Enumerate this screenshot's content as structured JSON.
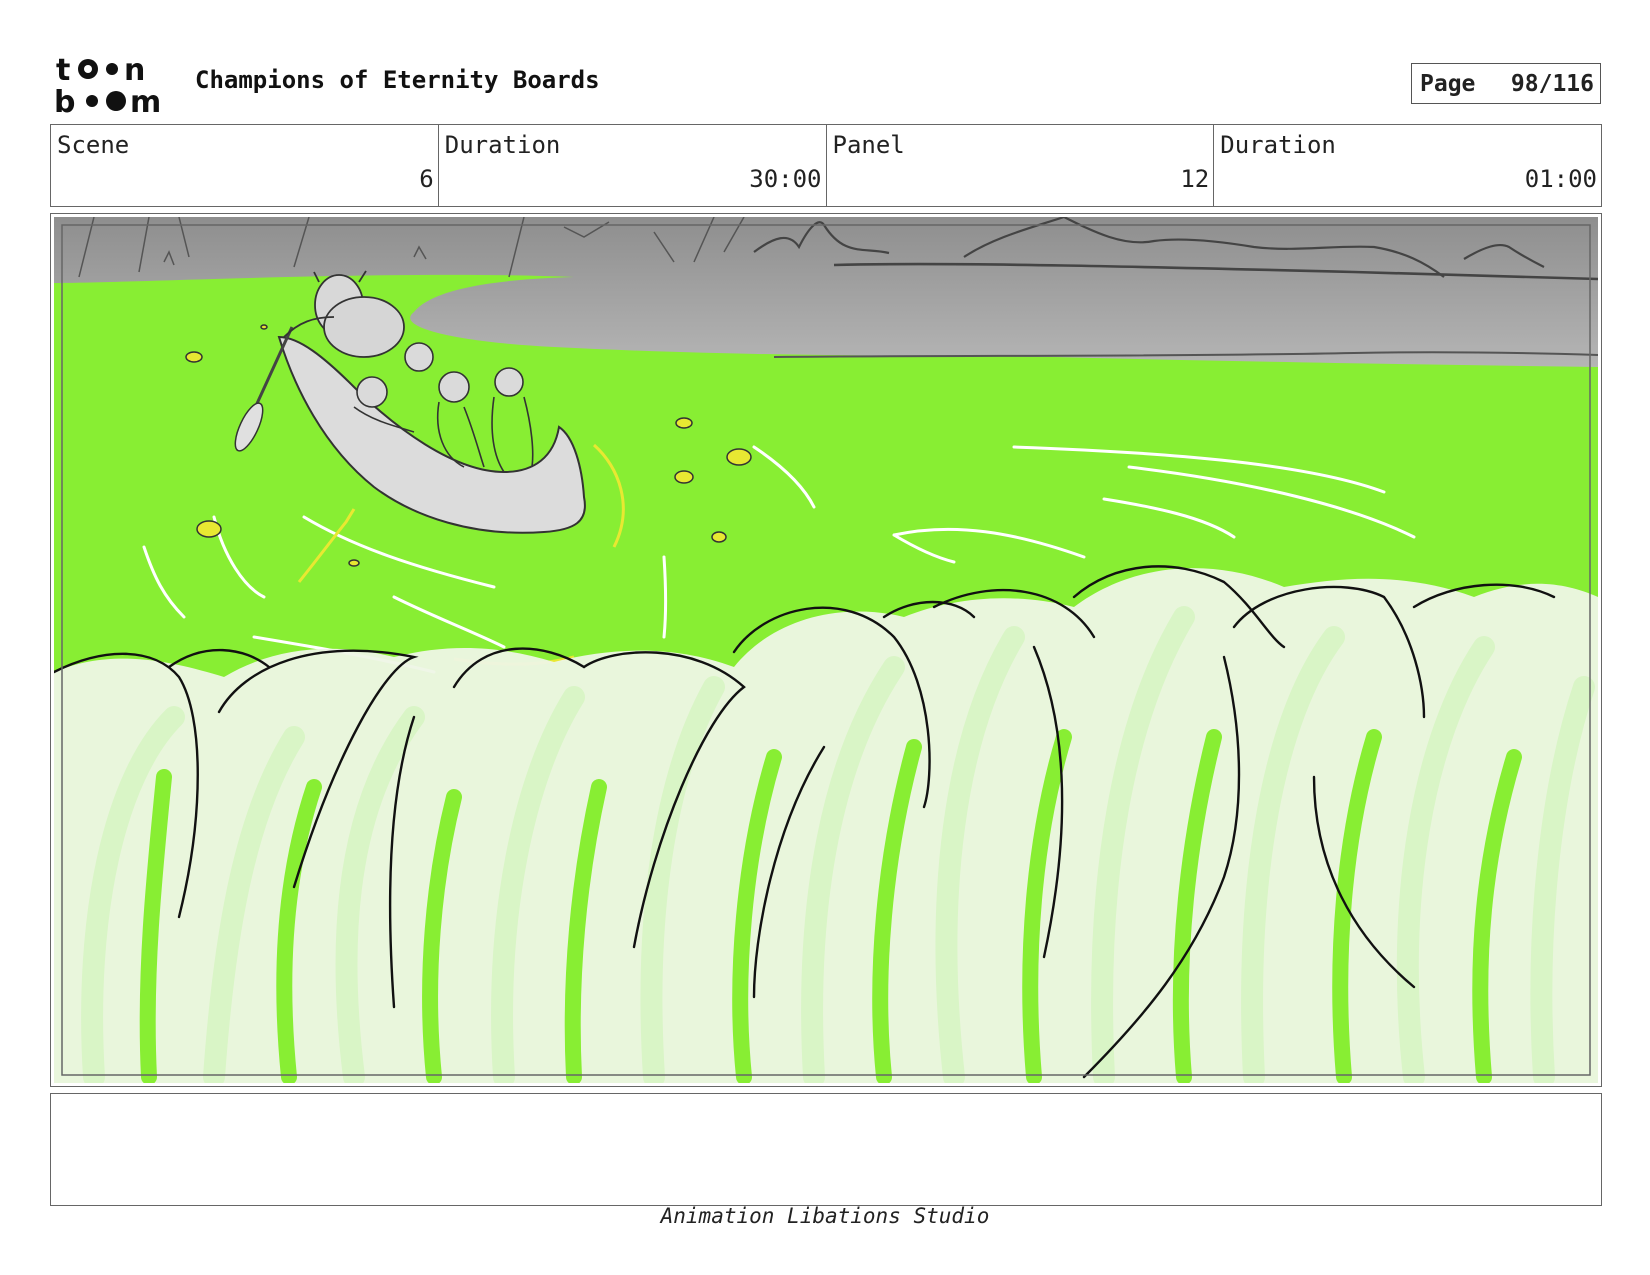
{
  "header": {
    "logo_text": "toonboom",
    "title": "Champions of Eternity Boards",
    "page_label": "Page",
    "page_number": "98/116"
  },
  "info": {
    "scene_label": "Scene",
    "scene_value": "6",
    "scene_duration_label": "Duration",
    "scene_duration_value": "30:00",
    "panel_label": "Panel",
    "panel_value": "12",
    "panel_duration_label": "Duration",
    "panel_duration_value": "01:00"
  },
  "panel": {
    "water_color": "#88ee33",
    "sky_color": "#9e9e9e",
    "foam_color": "#eef6e6",
    "highlight_color": "#e8e832"
  },
  "notes": {
    "text": ""
  },
  "footer": {
    "studio": "Animation Libations Studio"
  }
}
